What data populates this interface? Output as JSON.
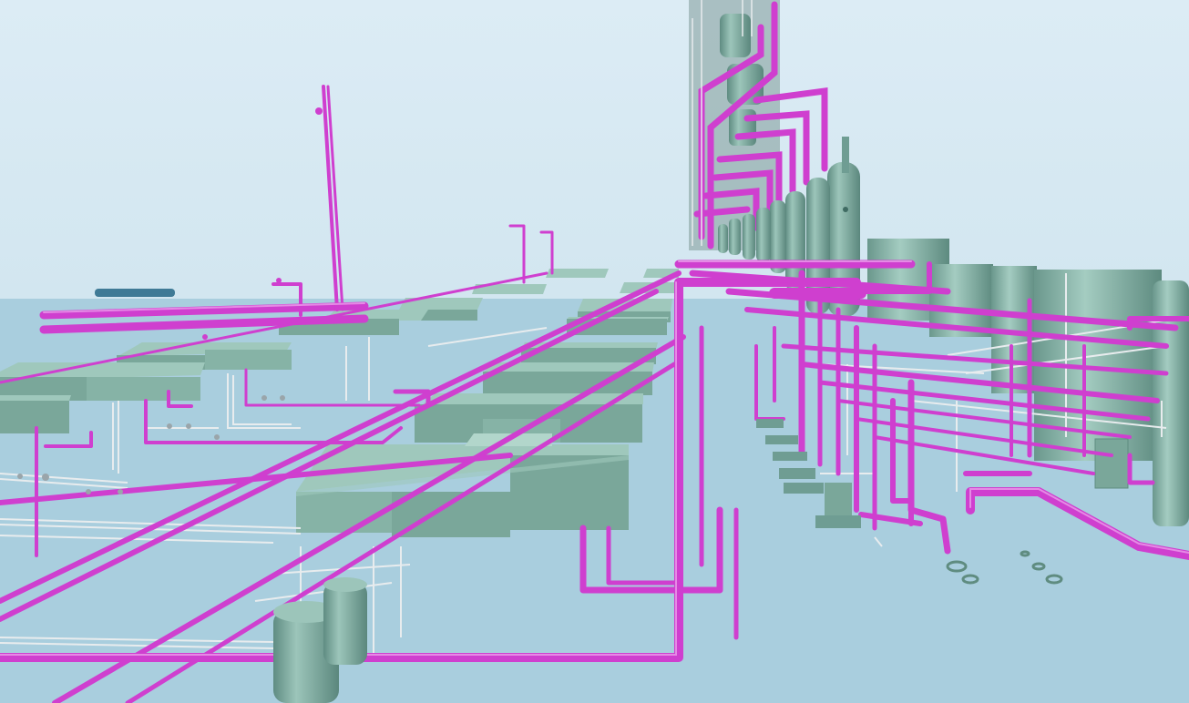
{
  "scene": {
    "kind": "3d-plant-piping-model",
    "colors": {
      "sky": "#d8eaf3",
      "ground": "#a9cede",
      "pipe_main": "#cf3fcf",
      "pipe_highlight": "#e277e2",
      "pipe_shadow": "#9a2a9a",
      "equipment_top": "#9fc8bc",
      "equipment_side": "#7aa79a",
      "equipment_dark": "#5f8c80",
      "vessel": "#6f9d93",
      "vessel_light": "#93bcb2",
      "small_pipe": "#e8ecee",
      "small_pipe_shadow": "#9aa5aa",
      "structure": "#8c9b9e",
      "far_vessel": "#3f7a96"
    }
  }
}
